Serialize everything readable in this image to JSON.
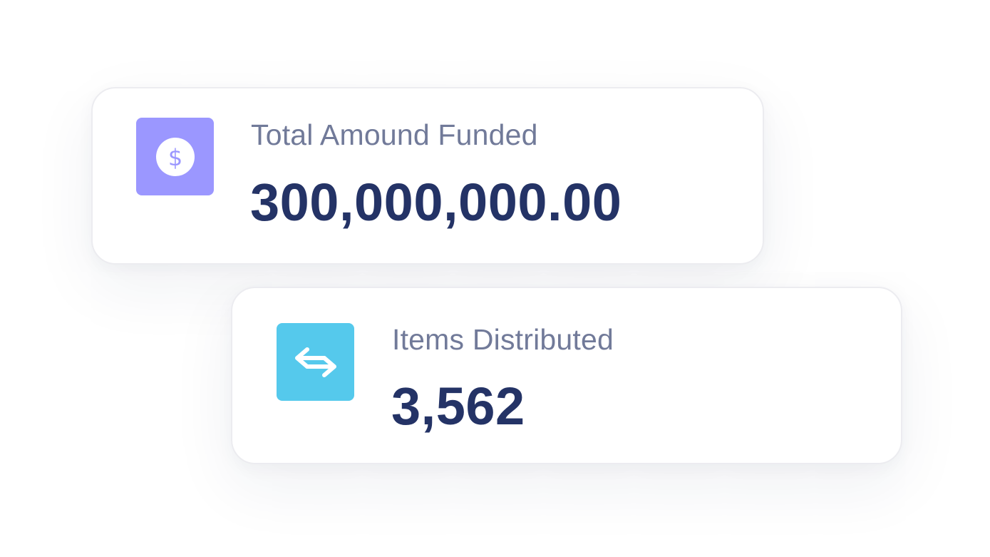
{
  "colors": {
    "label": "#717a99",
    "value": "#243366",
    "funded_tile": "#9b97ff",
    "funded_icon_fg": "#9b97ff",
    "items_tile": "#55c9ec"
  },
  "cards": [
    {
      "label": "Total Amound Funded",
      "value": "300,000,000.00",
      "icon": "dollar-coin-icon"
    },
    {
      "label": "Items Distributed",
      "value": "3,562",
      "icon": "transfer-arrows-icon"
    }
  ]
}
